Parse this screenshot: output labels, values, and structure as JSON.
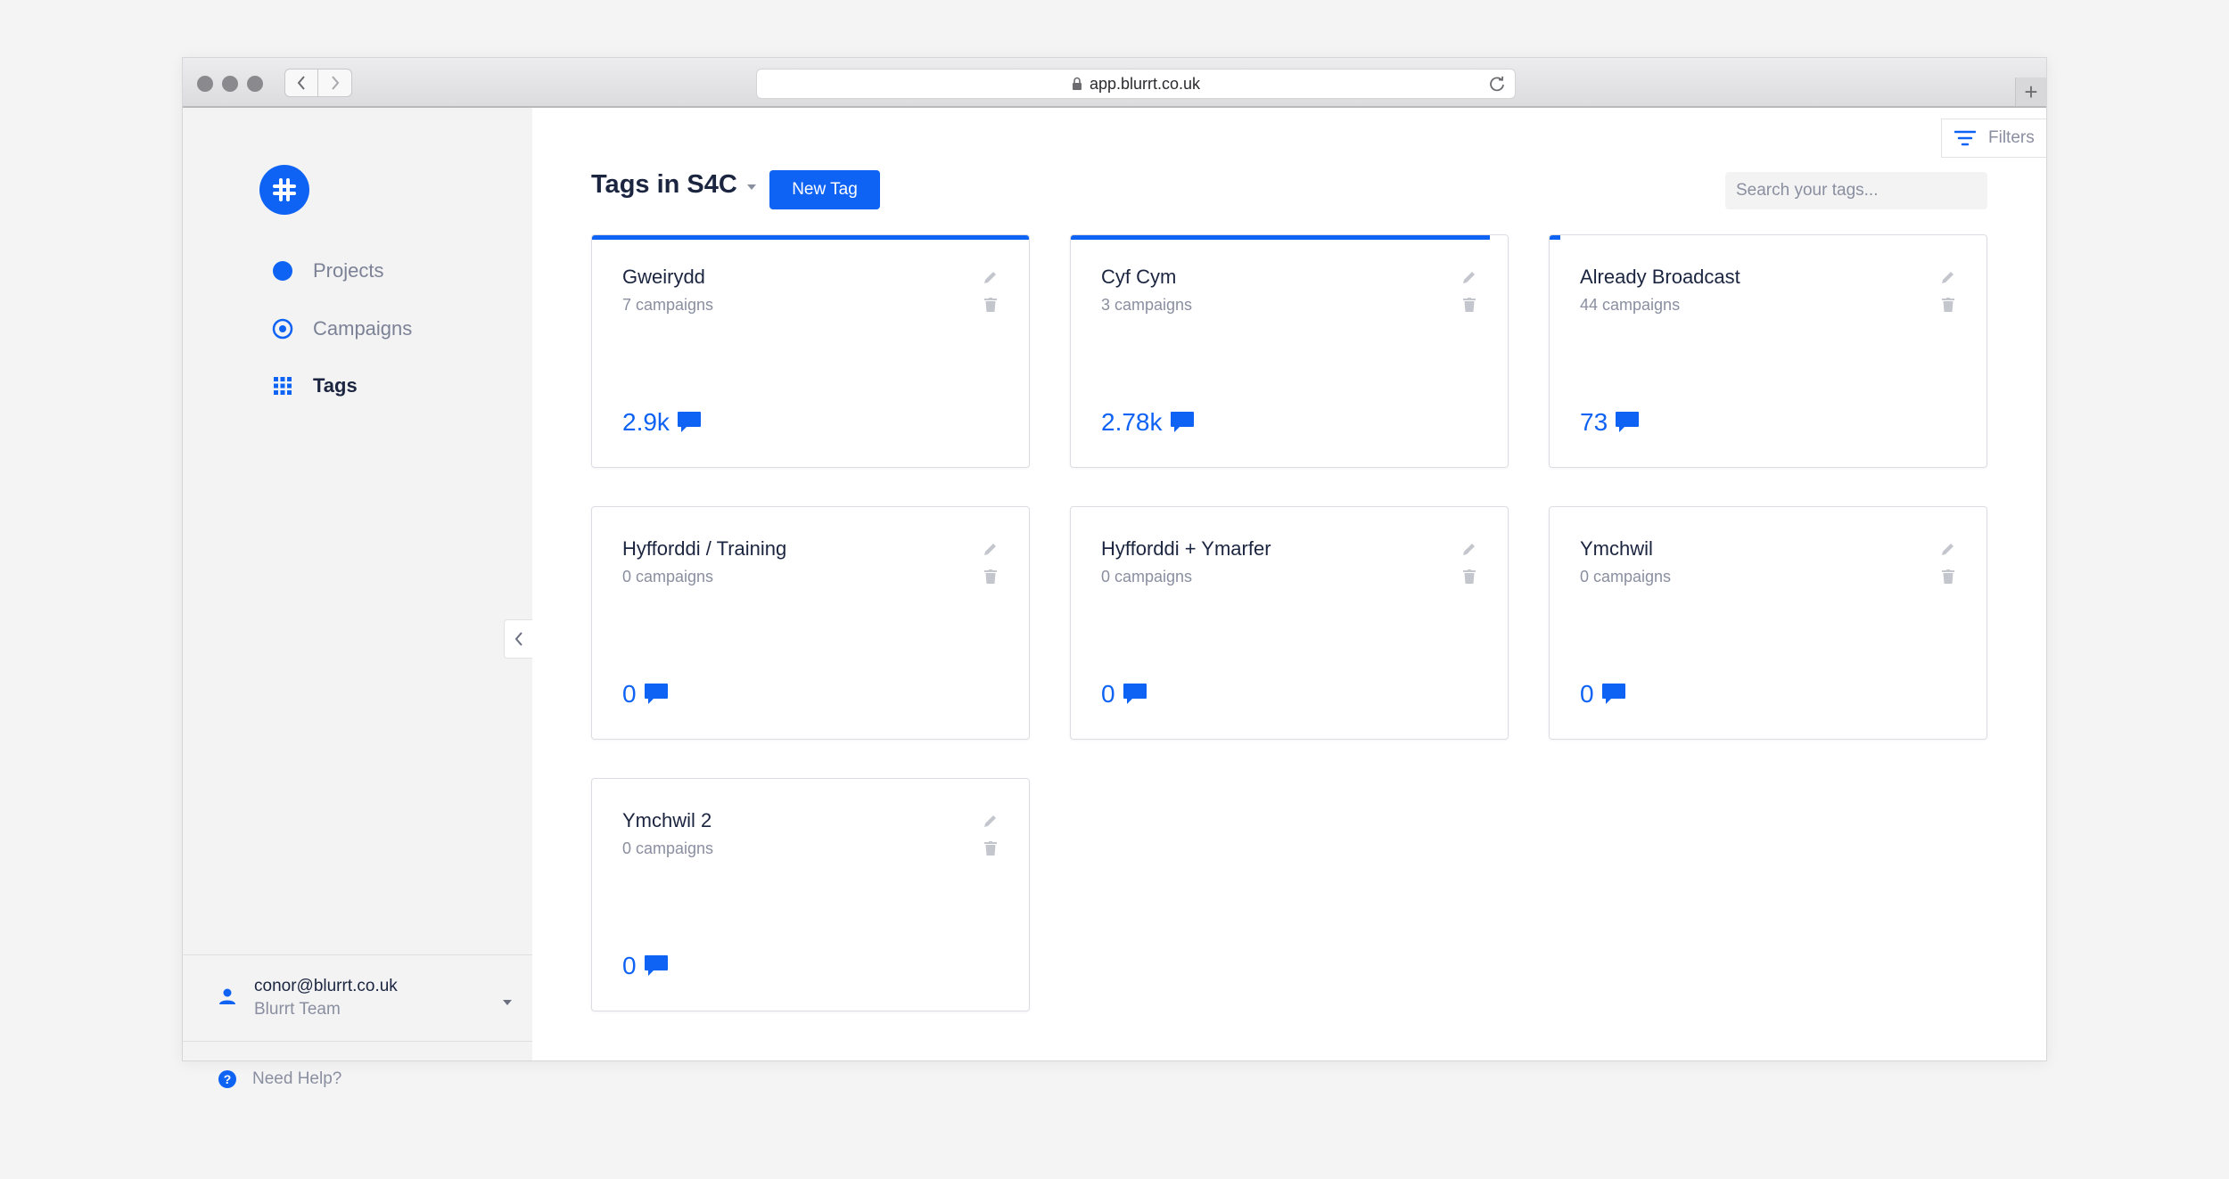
{
  "browser": {
    "url": "app.blurrt.co.uk",
    "new_tab_label": "+"
  },
  "sidebar": {
    "logo": "hashtag-logo",
    "items": [
      {
        "label": "Projects",
        "icon": "filled-circle-icon",
        "active": false
      },
      {
        "label": "Campaigns",
        "icon": "target-circle-icon",
        "active": false
      },
      {
        "label": "Tags",
        "icon": "grid-dots-icon",
        "active": true
      }
    ],
    "user": {
      "email": "conor@blurrt.co.uk",
      "team": "Blurrt Team"
    },
    "help_label": "Need Help?"
  },
  "main": {
    "title": "Tags in S4C",
    "new_tag_label": "New Tag",
    "filters_label": "Filters",
    "search_placeholder": "Search your tags..."
  },
  "tags": [
    {
      "name": "Gweirydd",
      "campaigns": "7 campaigns",
      "mentions": "2.9k",
      "bar_fraction": 1.0
    },
    {
      "name": "Cyf Cym",
      "campaigns": "3 campaigns",
      "mentions": "2.78k",
      "bar_fraction": 0.96
    },
    {
      "name": "Already Broadcast",
      "campaigns": "44 campaigns",
      "mentions": "73",
      "bar_fraction": 0.025
    },
    {
      "name": "Hyfforddi / Training",
      "campaigns": "0 campaigns",
      "mentions": "0",
      "bar_fraction": 0
    },
    {
      "name": "Hyfforddi + Ymarfer",
      "campaigns": "0 campaigns",
      "mentions": "0",
      "bar_fraction": 0
    },
    {
      "name": "Ymchwil",
      "campaigns": "0 campaigns",
      "mentions": "0",
      "bar_fraction": 0
    },
    {
      "name": "Ymchwil 2",
      "campaigns": "0 campaigns",
      "mentions": "0",
      "bar_fraction": 0
    }
  ],
  "colors": {
    "accent": "#0f63f4",
    "text": "#1b2540",
    "muted": "#8a8fa0",
    "sidebar_bg": "#f3f3f4"
  }
}
